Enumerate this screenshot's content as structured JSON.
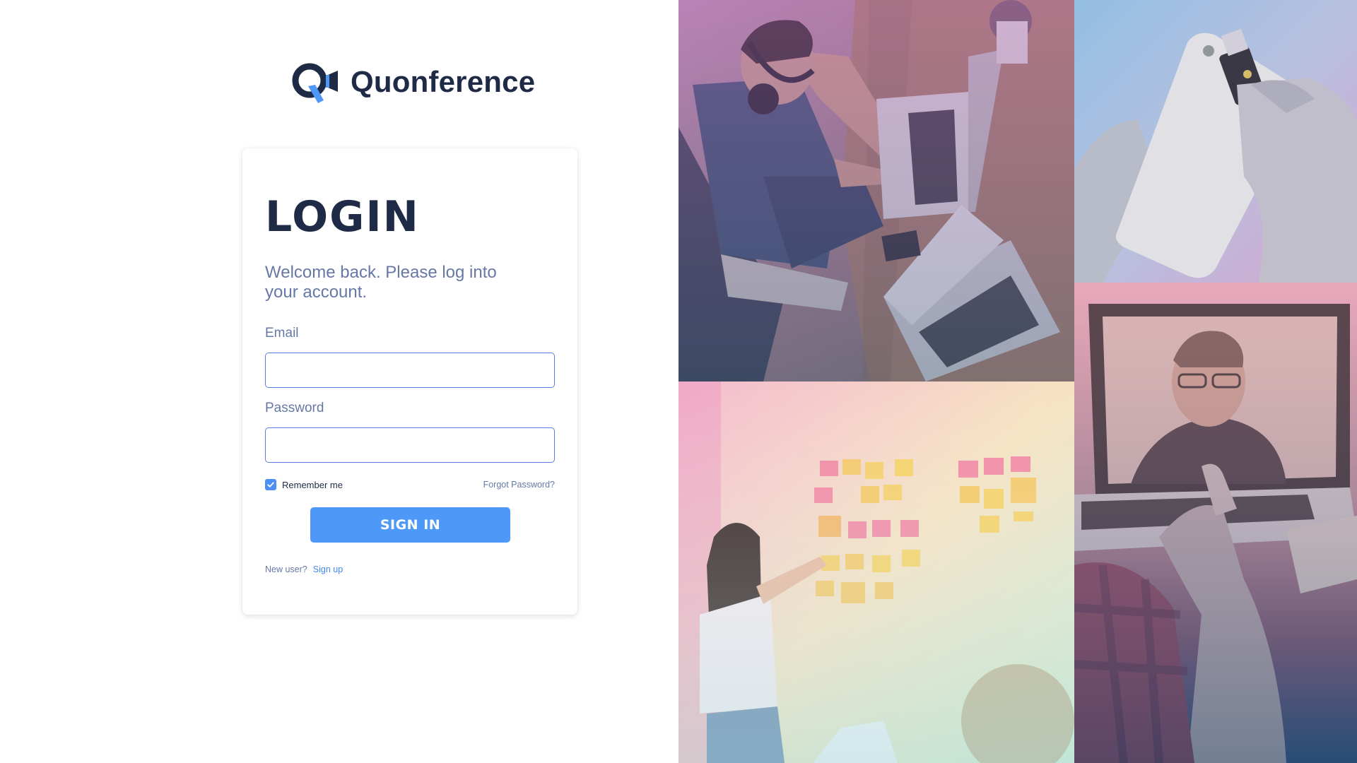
{
  "brand": {
    "name": "Quonference",
    "logo_icon": "quonference-logo-icon"
  },
  "login": {
    "title": "LOGIN",
    "subtitle": "Welcome back. Please log into your account.",
    "email_label": "Email",
    "email_value": "",
    "password_label": "Password",
    "password_value": "",
    "remember_label": "Remember me",
    "remember_checked": true,
    "forgot_label": "Forgot Password?",
    "signin_label": "SIGN IN",
    "newuser_text": "New user?",
    "signup_label": "Sign up"
  },
  "colors": {
    "brand_dark": "#1f2a47",
    "muted_text": "#6678a6",
    "accent_blue": "#4e98f8",
    "link_blue": "#3f86f0"
  },
  "collage": {
    "tiles": [
      "coworking-photo",
      "security-key-photo",
      "sticky-notes-photo",
      "video-call-photo"
    ]
  }
}
